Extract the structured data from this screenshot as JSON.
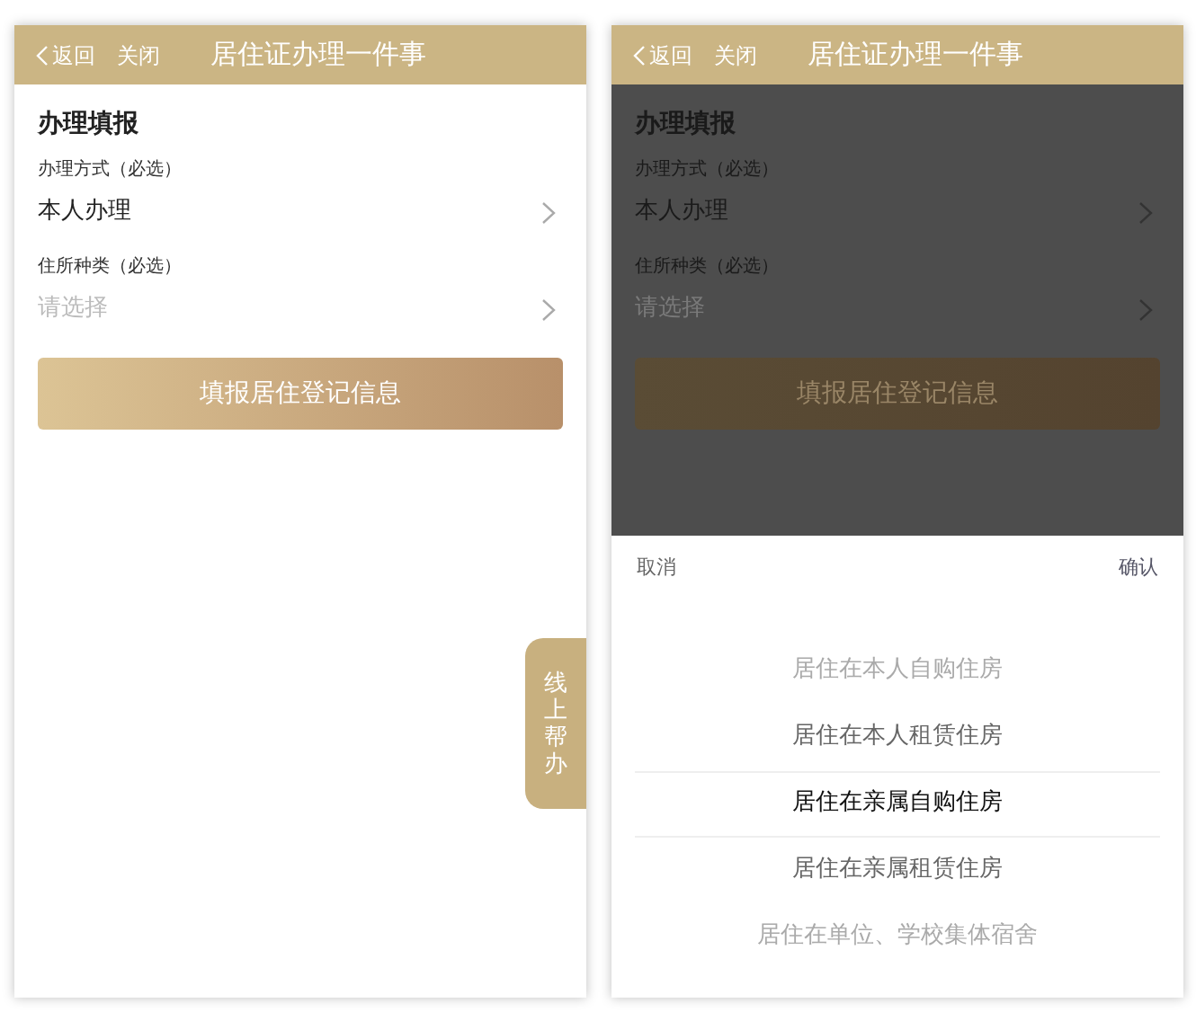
{
  "screens": [
    {
      "dimmed": false,
      "header": {
        "back": "返回",
        "close": "关闭",
        "title": "居住证办理一件事"
      },
      "form": {
        "section_title": "办理填报",
        "fields": [
          {
            "label": "办理方式（必选）",
            "value": "本人办理"
          },
          {
            "label": "住所种类（必选）",
            "placeholder": "请选择"
          }
        ],
        "submit_button": "填报居住登记信息"
      },
      "help_tab": "线上帮办"
    },
    {
      "dimmed": true,
      "header": {
        "back": "返回",
        "close": "关闭",
        "title": "居住证办理一件事"
      },
      "form": {
        "section_title": "办理填报",
        "fields": [
          {
            "label": "办理方式（必选）",
            "value": "本人办理"
          },
          {
            "label": "住所种类（必选）",
            "placeholder": "请选择"
          }
        ],
        "submit_button": "填报居住登记信息"
      },
      "picker": {
        "cancel": "取消",
        "confirm": "确认",
        "options": [
          {
            "label": "居住在本人自购住房",
            "selected": false
          },
          {
            "label": "居住在本人租赁住房",
            "selected": false
          },
          {
            "label": "居住在亲属自购住房",
            "selected": true
          },
          {
            "label": "居住在亲属租赁住房",
            "selected": false
          },
          {
            "label": "居住在单位、学校集体宿舍",
            "selected": false
          }
        ]
      }
    }
  ]
}
